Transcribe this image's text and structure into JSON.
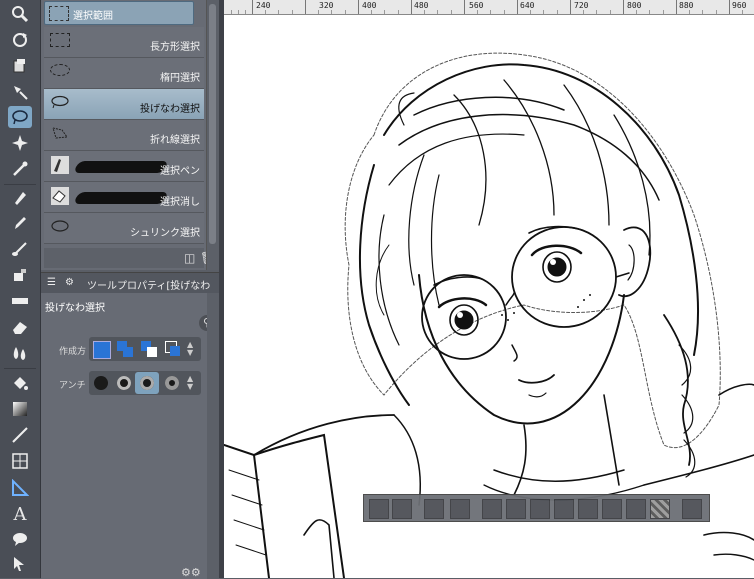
{
  "subtool": {
    "header_label": "選択範囲",
    "items": [
      {
        "label": "長方形選択",
        "icon": "rectangle-marquee-icon"
      },
      {
        "label": "楕円選択",
        "icon": "ellipse-marquee-icon"
      },
      {
        "label": "投げなわ選択",
        "icon": "lasso-icon"
      },
      {
        "label": "折れ線選択",
        "icon": "polyline-select-icon"
      },
      {
        "label": "選択ペン",
        "icon": "selection-pen-icon"
      },
      {
        "label": "選択消し",
        "icon": "selection-eraser-icon"
      },
      {
        "label": "シュリンク選択",
        "icon": "shrink-select-icon"
      }
    ]
  },
  "toolprop": {
    "tab_label": "ツールプロパティ[投げなわ",
    "title": "投げなわ選択",
    "row1_label": "作成方",
    "row2_label": "アンチ"
  },
  "ruler": {
    "numbers": [
      "240",
      "320",
      "400",
      "480",
      "560",
      "640",
      "720",
      "800",
      "880",
      "960"
    ]
  },
  "colors": {
    "accent": "#7fa7c6",
    "panel": "#676b74",
    "canvas": "#ffffff"
  }
}
